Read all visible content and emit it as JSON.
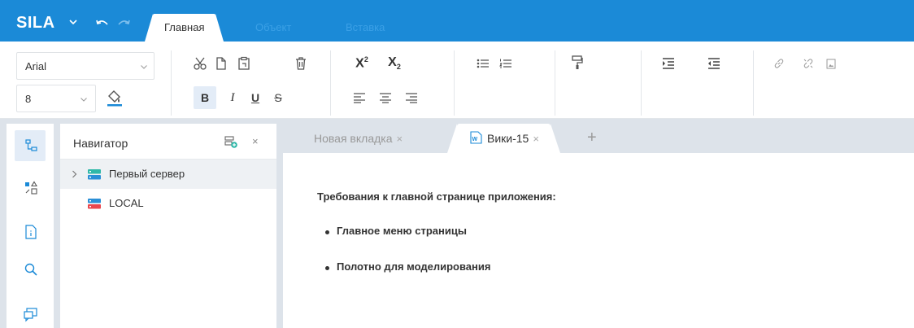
{
  "app": {
    "logo": "SILA",
    "tabs": [
      "Главная",
      "Объект",
      "Вставка"
    ]
  },
  "ribbon": {
    "font_family": "Arial",
    "font_size": "8",
    "buttons": {
      "bold": "B",
      "italic": "I",
      "underline": "U",
      "strike": "S",
      "superscript_base": "X",
      "superscript_mark": "2",
      "subscript_base": "X",
      "subscript_mark": "2"
    }
  },
  "navigator": {
    "title": "Навигатор",
    "close": "×",
    "items": [
      {
        "label": "Первый сервер",
        "expandable": true
      },
      {
        "label": "LOCAL",
        "expandable": false
      }
    ]
  },
  "doc_tabs": [
    {
      "label": "Новая вкладка",
      "close": "×",
      "active": false
    },
    {
      "label": "Вики-15",
      "close": "×",
      "active": true
    }
  ],
  "new_tab": "+",
  "document": {
    "heading": "Требования к главной странице приложения:",
    "bullets": [
      "Главное меню страницы",
      "Полотно для моделирования"
    ]
  },
  "colors": {
    "accent": "#1b8ad7",
    "server_top": "#2fb8a8",
    "server_bottom": "#2a8fd6",
    "local_top": "#e9474f",
    "local_bottom": "#2a8fd6"
  },
  "icons": [
    "chevron-down-icon",
    "undo-icon",
    "redo-icon",
    "cut-icon",
    "copy-icon",
    "paste-icon",
    "delete-icon",
    "fill-color-icon",
    "bullet-list-icon",
    "numbered-list-icon",
    "format-painter-icon",
    "indent-icon",
    "outdent-icon",
    "link-icon",
    "unlink-icon",
    "image-icon",
    "tree-icon",
    "objects-icon",
    "document-icon",
    "search-icon",
    "chat-icon",
    "add-server-icon",
    "server-icon",
    "word-doc-icon"
  ]
}
